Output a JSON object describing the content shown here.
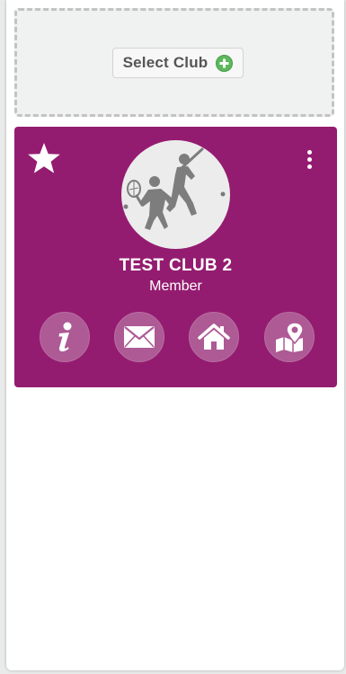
{
  "select_club": {
    "label": "Select Club",
    "add_icon": "plus-circle-icon"
  },
  "club_card": {
    "name": "TEST CLUB 2",
    "role": "Member",
    "favorite_icon": "star-icon",
    "menu_icon": "more-vertical-icon",
    "logo_icon": "tennis-golf-players-icon",
    "actions": [
      {
        "icon": "info-icon"
      },
      {
        "icon": "envelope-icon"
      },
      {
        "icon": "home-icon"
      },
      {
        "icon": "map-pin-icon"
      }
    ]
  },
  "colors": {
    "card_background": "#941c70",
    "action_circle": "#ad5a95",
    "add_icon_green": "#5cb85c",
    "select_area_background": "#f0f1f1"
  }
}
